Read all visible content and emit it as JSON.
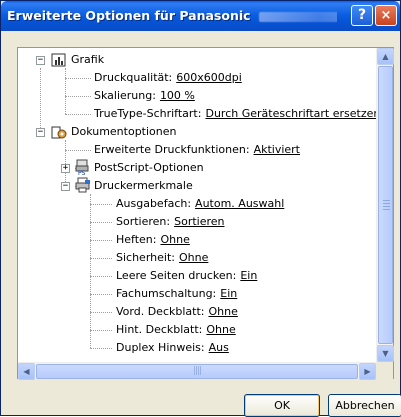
{
  "window": {
    "title": "Erweiterte Optionen für Panasonic",
    "help_label": "?",
    "close_label": "×"
  },
  "tree": {
    "grafik": {
      "label": "Grafik",
      "items": [
        {
          "label": "Druckqualität:",
          "value": "600x600dpi"
        },
        {
          "label": "Skalierung:",
          "value": "100 %"
        },
        {
          "label": "TrueType-Schriftart:",
          "value": "Durch Geräteschriftart ersetzen"
        }
      ]
    },
    "dokument": {
      "label": "Dokumentoptionen",
      "erweiterte": {
        "label": "Erweiterte Druckfunktionen:",
        "value": "Aktiviert"
      },
      "postscript": {
        "label": "PostScript-Optionen"
      },
      "druckermerkmale": {
        "label": "Druckermerkmale",
        "items": [
          {
            "label": "Ausgabefach:",
            "value": "Autom. Auswahl"
          },
          {
            "label": "Sortieren:",
            "value": "Sortieren"
          },
          {
            "label": "Heften:",
            "value": "Ohne"
          },
          {
            "label": "Sicherheit:",
            "value": "Ohne"
          },
          {
            "label": "Leere Seiten drucken:",
            "value": "Ein"
          },
          {
            "label": "Fachumschaltung:",
            "value": "Ein"
          },
          {
            "label": "Vord. Deckblatt:",
            "value": "Ohne"
          },
          {
            "label": "Hint. Deckblatt:",
            "value": "Ohne"
          },
          {
            "label": "Duplex Hinweis:",
            "value": "Aus"
          }
        ]
      }
    },
    "expander_minus": "−",
    "expander_plus": "+"
  },
  "scroll": {
    "up": "▲",
    "down": "▼",
    "left": "◀",
    "right": "▶",
    "hgrip": "||||"
  },
  "buttons": {
    "ok": "OK",
    "cancel": "Abbrechen"
  }
}
